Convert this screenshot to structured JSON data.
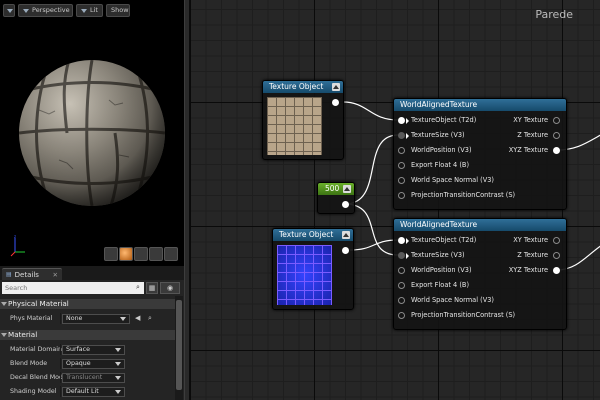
{
  "viewport": {
    "menu_icon": "menu-icon",
    "view_mode": "Perspective",
    "lighting": "Lit",
    "show_label": "Show"
  },
  "details": {
    "tab_label": "Details",
    "search_placeholder": "Search",
    "categories": {
      "physical_material": "Physical Material",
      "material": "Material"
    },
    "phys_material": {
      "label": "Phys Material",
      "value": "None"
    },
    "properties": [
      {
        "label": "Material Domain",
        "value": "Surface",
        "enabled": true
      },
      {
        "label": "Blend Mode",
        "value": "Opaque",
        "enabled": true
      },
      {
        "label": "Decal Blend Mode",
        "value": "Translucent",
        "enabled": false
      },
      {
        "label": "Shading Model",
        "value": "Default Lit",
        "enabled": true
      }
    ]
  },
  "graph": {
    "title": "Parede",
    "texture_object_1": {
      "title": "Texture Object"
    },
    "texture_object_2": {
      "title": "Texture Object"
    },
    "constant": {
      "value": "500"
    },
    "world_aligned_1": {
      "title": "WorldAlignedTexture",
      "inputs": [
        "TextureObject (T2d)",
        "TextureSize (V3)",
        "WorldPosition (V3)",
        "Export Float 4 (B)",
        "World Space Normal (V3)",
        "ProjectionTransitionContrast (S)"
      ],
      "outputs": [
        "XY Texture",
        "Z Texture",
        "XYZ Texture"
      ]
    },
    "world_aligned_2": {
      "title": "WorldAlignedTexture",
      "inputs": [
        "TextureObject (T2d)",
        "TextureSize (V3)",
        "WorldPosition (V3)",
        "Export Float 4 (B)",
        "World Space Normal (V3)",
        "ProjectionTransitionContrast (S)"
      ],
      "outputs": [
        "XY Texture",
        "Z Texture",
        "XYZ Texture"
      ]
    }
  },
  "colors": {
    "node_header": "#1f5a82",
    "constant_header": "#4d8a1e",
    "wire": "#ffffff",
    "normal_map_blue": "#2233dd"
  }
}
